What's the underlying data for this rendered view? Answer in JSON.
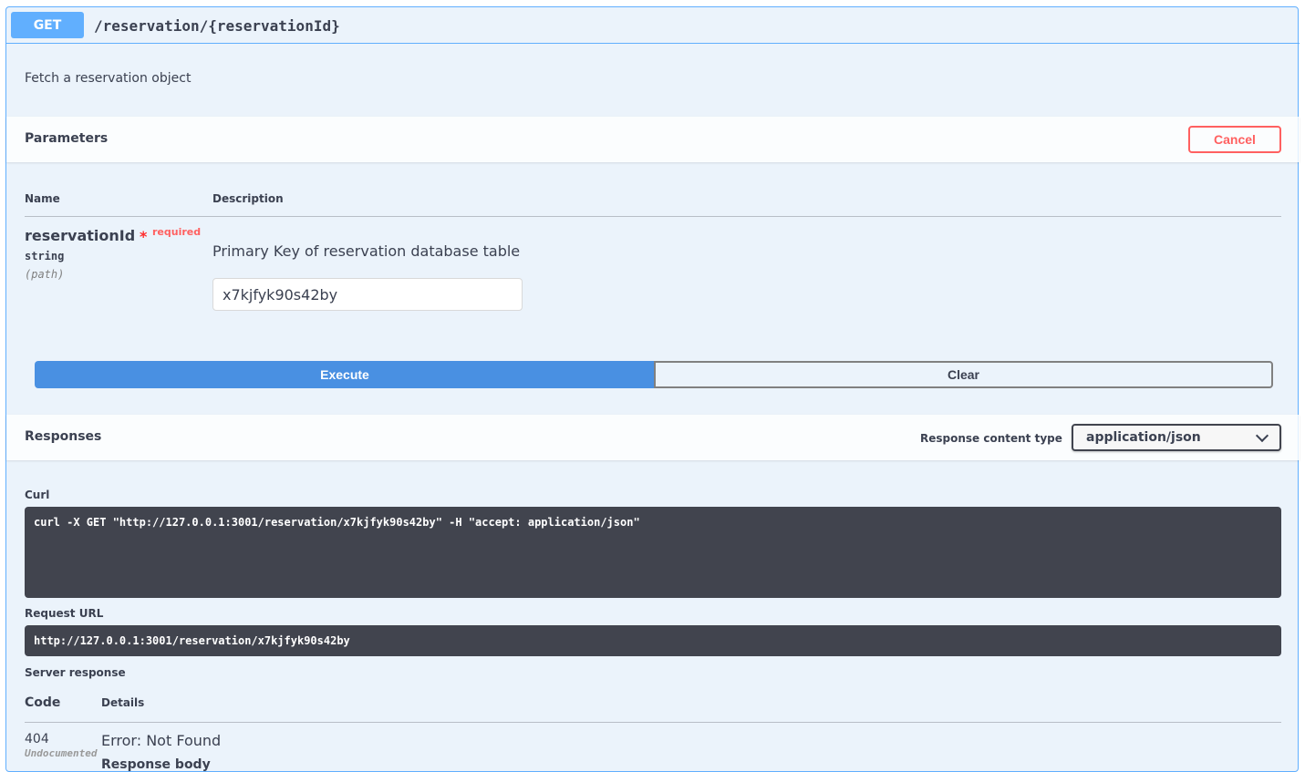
{
  "operation": {
    "method": "GET",
    "path": "/reservation/{reservationId}",
    "description": "Fetch a reservation object"
  },
  "parameters": {
    "title": "Parameters",
    "cancel_label": "Cancel",
    "col_name": "Name",
    "col_description": "Description",
    "param": {
      "name": "reservationId",
      "required_star": "*",
      "required_label": "required",
      "type": "string",
      "in": "(path)",
      "description": "Primary Key of reservation database table",
      "value": "x7kjfyk90s42by"
    }
  },
  "actions": {
    "execute_label": "Execute",
    "clear_label": "Clear"
  },
  "responses": {
    "title": "Responses",
    "content_type_label": "Response content type",
    "content_type_value": "application/json",
    "curl_label": "Curl",
    "curl_command": "curl -X GET \"http://127.0.0.1:3001/reservation/x7kjfyk90s42by\" -H \"accept: application/json\"",
    "request_url_label": "Request URL",
    "request_url": "http://127.0.0.1:3001/reservation/x7kjfyk90s42by",
    "server_response_label": "Server response",
    "col_code": "Code",
    "col_details": "Details",
    "code": "404",
    "code_note": "Undocumented",
    "error_text": "Error: Not Found",
    "body_label": "Response body"
  },
  "colors": {
    "get_blue": "#61affe",
    "execute_blue": "#4990e2",
    "cancel_red": "#ff6060",
    "code_bg": "#41444e",
    "panel_bg": "#ebf3fb"
  }
}
